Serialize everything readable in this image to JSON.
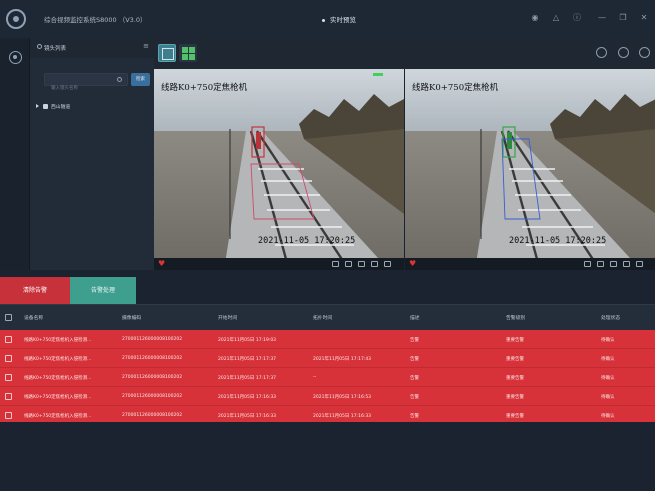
{
  "app": {
    "title": "综合视频监控系统S8000 （V3.0）",
    "center_tab": "实时预览"
  },
  "camera_panel": {
    "title": "镜头列表",
    "search_placeholder": "输入镜头名称",
    "search_button": "检索",
    "tree": [
      {
        "label": "西山隧道"
      }
    ]
  },
  "videos": [
    {
      "overlay_title": "线路K0+750定焦枪机",
      "overlay_time": "2021-11-05 17:20:25",
      "detection_color": "#c4353c"
    },
    {
      "overlay_title": "线路K0+750定焦枪机",
      "overlay_time": "2021-11-05 17:20:25",
      "detection_color": "#3aa64a"
    }
  ],
  "actions": {
    "clear_label": "清除告警",
    "handle_label": "告警处理"
  },
  "table": {
    "columns": [
      "设备名称",
      "摄像编码",
      "开始时间",
      "拓扑时间",
      "描述",
      "告警级别",
      "处理状态"
    ],
    "rows": [
      [
        "线路K0+750定焦枪机入侵检测...",
        "270001126000008100202",
        "2021年11月05日 17:19:03",
        "",
        "告警",
        "重要告警",
        "待确认"
      ],
      [
        "线路K0+750定焦枪机入侵检测...",
        "270001126000008100202",
        "2021年11月05日 17:17:37",
        "2021年11月05日 17:17:43",
        "告警",
        "重要告警",
        "待确认"
      ],
      [
        "线路K0+750定焦枪机入侵检测...",
        "270001126000008100202",
        "2021年11月05日 17:17:37",
        "--",
        "告警",
        "重要告警",
        "待确认"
      ],
      [
        "线路K0+750定焦枪机入侵检测...",
        "270001126000008100202",
        "2021年11月05日 17:16:33",
        "2021年11月05日 17:16:53",
        "告警",
        "重要告警",
        "待确认"
      ],
      [
        "线路K0+750定焦枪机入侵检测...",
        "270001126000008100202",
        "2021年11月05日 17:16:33",
        "2021年11月05日 17:16:33",
        "告警",
        "重要告警",
        "待确认"
      ]
    ]
  },
  "colors": {
    "alarm_row": "#d7323a",
    "clear_button": "#c6313a",
    "handle_button": "#3f9f8f",
    "background": "#1b2330"
  },
  "icons": [
    "app-logo-icon",
    "lock-icon",
    "bell-icon",
    "info-icon",
    "minimize-icon",
    "maximize-icon",
    "close-icon",
    "camera-nav-icon",
    "search-icon",
    "heart-icon"
  ]
}
